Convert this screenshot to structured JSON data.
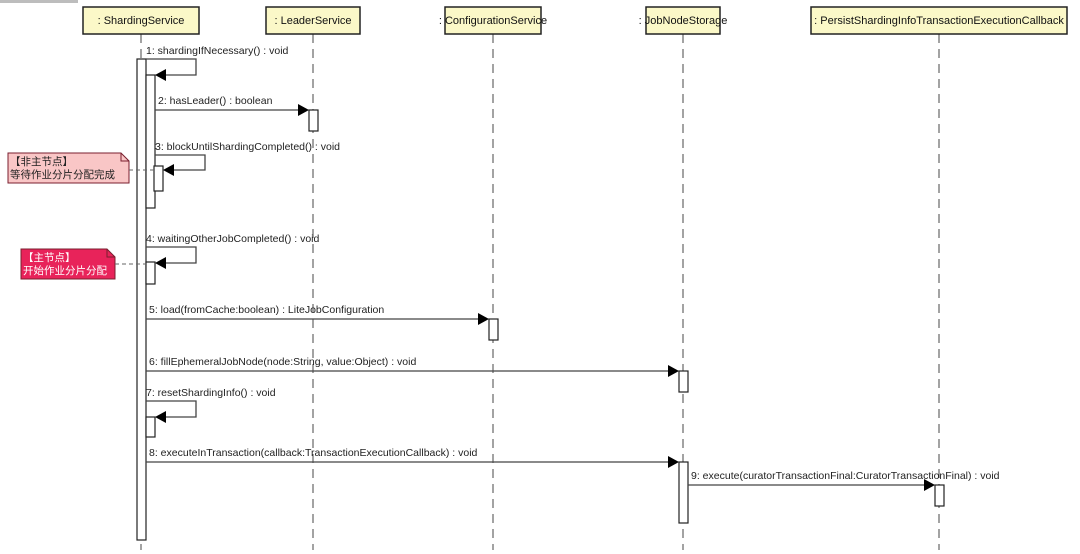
{
  "diagram": {
    "type": "UML sequence diagram",
    "lifelines": [
      {
        "id": "sharding",
        "label": ": ShardingService"
      },
      {
        "id": "leader",
        "label": ": LeaderService"
      },
      {
        "id": "config",
        "label": ": ConfigurationService"
      },
      {
        "id": "jobnode",
        "label": ": JobNodeStorage"
      },
      {
        "id": "persist",
        "label": ": PersistShardingInfoTransactionExecutionCallback"
      }
    ],
    "messages": [
      {
        "num": 1,
        "label": "1: shardingIfNecessary() : void",
        "from": "sharding",
        "to": "sharding",
        "self": true
      },
      {
        "num": 2,
        "label": "2: hasLeader() : boolean",
        "from": "sharding",
        "to": "leader",
        "self": false
      },
      {
        "num": 3,
        "label": "3: blockUntilShardingCompleted() : void",
        "from": "sharding",
        "to": "sharding",
        "self": true
      },
      {
        "num": 4,
        "label": "4: waitingOtherJobCompleted() : void",
        "from": "sharding",
        "to": "sharding",
        "self": true
      },
      {
        "num": 5,
        "label": "5: load(fromCache:boolean) : LiteJobConfiguration",
        "from": "sharding",
        "to": "config",
        "self": false
      },
      {
        "num": 6,
        "label": "6: fillEphemeralJobNode(node:String, value:Object) : void",
        "from": "sharding",
        "to": "jobnode",
        "self": false
      },
      {
        "num": 7,
        "label": "7: resetShardingInfo() : void",
        "from": "sharding",
        "to": "sharding",
        "self": true
      },
      {
        "num": 8,
        "label": "8: executeInTransaction(callback:TransactionExecutionCallback) : void",
        "from": "sharding",
        "to": "jobnode",
        "self": false
      },
      {
        "num": 9,
        "label": "9: execute(curatorTransactionFinal:CuratorTransactionFinal) : void",
        "from": "jobnode",
        "to": "persist",
        "self": false
      }
    ],
    "notes": [
      {
        "id": "non-master",
        "title": "【非主节点】",
        "body": "等待作业分片分配完成",
        "fill": "#f9c6c6",
        "text_color": "#222222",
        "attached_to_message": 3
      },
      {
        "id": "master",
        "title": "【主节点】",
        "body": "开始作业分片分配",
        "fill": "#e8235a",
        "text_color": "#ffffff",
        "attached_to_message": 4
      }
    ],
    "colors": {
      "lifeline_fill": "#fbf8c8",
      "lifeline_border": "#222222",
      "line": "#444444",
      "dash": "#666666",
      "note_border": "#7a1f2f"
    }
  }
}
